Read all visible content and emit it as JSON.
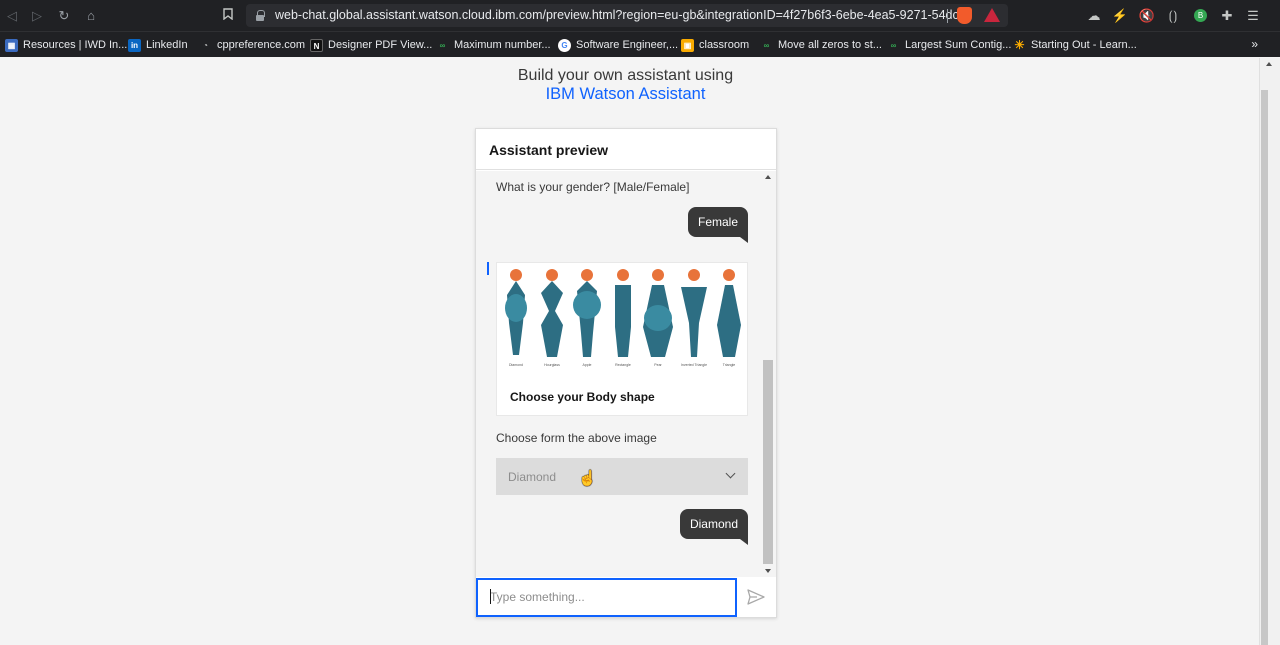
{
  "browser": {
    "url": "web-chat.global.assistant.watson.cloud.ibm.com/preview.html?region=eu-gb&integrationID=4f27b6f3-6ebe-4ea5-9271-54dcf7...",
    "profile_initial": "B",
    "bookmarks": [
      {
        "label": "Resources | IWD In...",
        "icon": "iwd-icon"
      },
      {
        "label": "LinkedIn",
        "icon": "linkedin-icon"
      },
      {
        "label": "cppreference.com",
        "icon": "cppreference-icon"
      },
      {
        "label": "Designer PDF View...",
        "icon": "pdf-viewer-icon"
      },
      {
        "label": "Maximum number...",
        "icon": "link-icon"
      },
      {
        "label": "Software Engineer,...",
        "icon": "google-icon"
      },
      {
        "label": "classroom",
        "icon": "classroom-icon"
      },
      {
        "label": "Move all zeros to st...",
        "icon": "link-icon"
      },
      {
        "label": "Largest Sum Contig...",
        "icon": "link-icon"
      },
      {
        "label": "Starting Out - Learn...",
        "icon": "sun-icon"
      }
    ],
    "more_bookmarks": "»"
  },
  "page": {
    "headline_line1": "Build your own assistant using",
    "headline_link": "IBM Watson Assistant"
  },
  "widget": {
    "title": "Assistant preview",
    "messages": {
      "gender_question": "What is your gender? [Male/Female]",
      "gender_answer": "Female",
      "card_title": "Choose your Body shape",
      "card_image_labels": [
        "Diamond",
        "Hourglass",
        "Apple",
        "Rectangle",
        "Pear",
        "Inverted Triangle",
        "Triangle"
      ],
      "choose_prompt": "Choose form the above image",
      "dropdown_value": "Diamond",
      "shape_answer": "Diamond"
    },
    "input_placeholder": "Type something..."
  },
  "colors": {
    "accent": "#0f62fe",
    "bubble": "#393939",
    "figure_body": "#2d6e83",
    "figure_hair": "#e8733a"
  }
}
